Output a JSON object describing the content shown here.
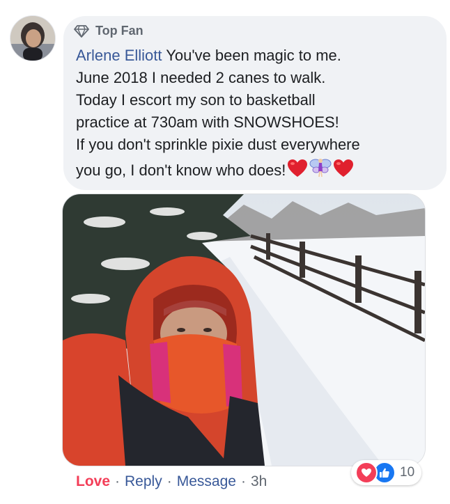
{
  "comment": {
    "badge": {
      "icon": "diamond-icon",
      "label": "Top Fan"
    },
    "author": "Arlene Elliott",
    "lines": [
      "You've been magic to me.",
      "June 2018 I needed 2 canes to walk.",
      "Today I escort my son to basketball",
      "practice at 730am with SNOWSHOES!",
      "If you don't sprinkle pixie dust everywhere",
      "you go, I don't know who does!"
    ],
    "emojis": [
      "red-heart-icon",
      "fairy-icon",
      "red-heart-icon"
    ]
  },
  "reactions": {
    "icons": [
      "love-reaction-icon",
      "like-reaction-icon"
    ],
    "count": "10"
  },
  "actions": {
    "love": "Love",
    "reply": "Reply",
    "message": "Message",
    "time": "3h",
    "separator": "·"
  },
  "colors": {
    "author_link": "#385898",
    "love_active": "#f33e58",
    "bubble_bg": "#f0f2f5",
    "muted": "#606770"
  }
}
